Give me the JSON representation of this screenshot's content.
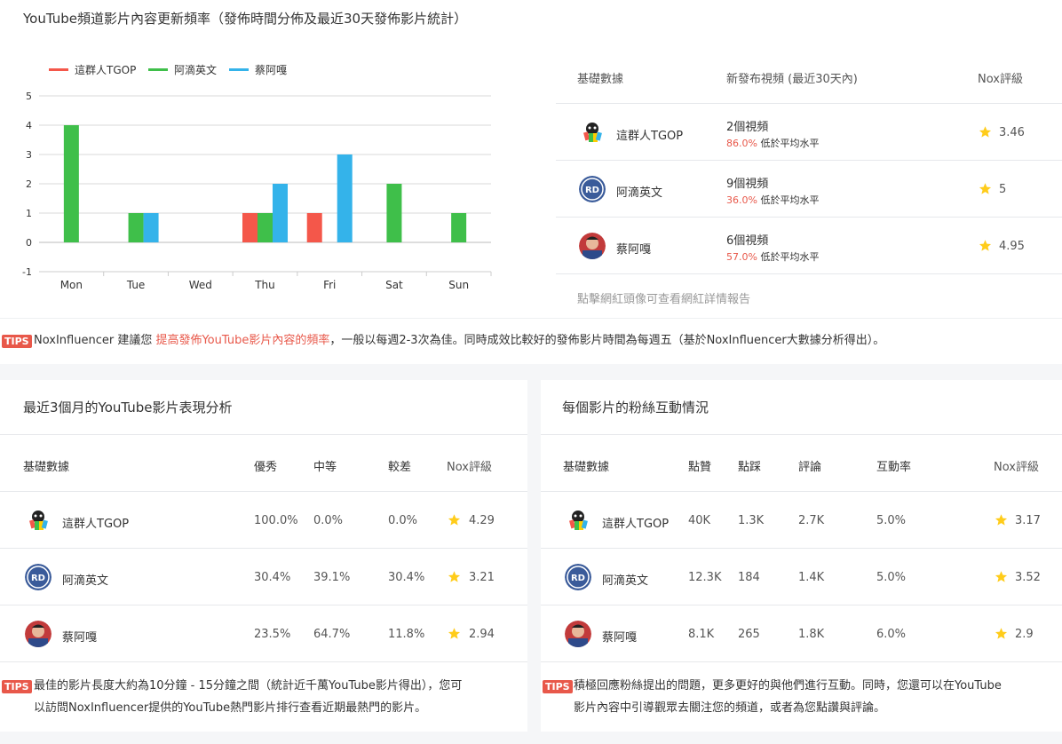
{
  "top": {
    "title": "YouTube頻道影片內容更新頻率（發佈時間分佈及最近30天發佈影片統計）"
  },
  "chart_data": {
    "type": "bar",
    "categories": [
      "Mon",
      "Tue",
      "Wed",
      "Thu",
      "Fri",
      "Sat",
      "Sun"
    ],
    "series": [
      {
        "name": "這群人TGOP",
        "color": "#f4574a",
        "values": [
          0,
          0,
          0,
          1,
          1,
          0,
          0
        ]
      },
      {
        "name": "阿滴英文",
        "color": "#3fbf4a",
        "values": [
          4,
          1,
          0,
          1,
          0,
          2,
          1
        ]
      },
      {
        "name": "蔡阿嘎",
        "color": "#34b3ea",
        "values": [
          0,
          1,
          0,
          2,
          3,
          0,
          0
        ]
      }
    ],
    "yticks": [
      "5",
      "4",
      "3",
      "2",
      "1",
      "0",
      "-1"
    ],
    "ylim": [
      -1,
      5
    ],
    "grid": true,
    "legend": "top-left"
  },
  "stats": {
    "headers": {
      "basic": "基礎數據",
      "new_videos": "新發布視頻 (最近30天內)",
      "nox": "Nox評級"
    },
    "rows": [
      {
        "name": "這群人TGOP",
        "videos": "2個視頻",
        "pct": "86.0%",
        "below": "低於平均水平",
        "rating": "3.46"
      },
      {
        "name": "阿滴英文",
        "videos": "9個視頻",
        "pct": "36.0%",
        "below": "低於平均水平",
        "rating": "5"
      },
      {
        "name": "蔡阿嘎",
        "videos": "6個視頻",
        "pct": "57.0%",
        "below": "低於平均水平",
        "rating": "4.95"
      }
    ],
    "footer": "點擊網紅頭像可查看網紅詳情報告"
  },
  "tips1": {
    "badge": "TIPS",
    "prefix": "NoxInfluencer 建議您 ",
    "highlight": "提高發佈YouTube影片內容的頻率",
    "suffix": "，一般以每週2-3次為佳。同時成效比較好的發佈影片時間為每週五（基於NoxInfluencer大數據分析得出）。"
  },
  "perf": {
    "title": "最近3個月的YouTube影片表現分析",
    "headers": {
      "basic": "基礎數據",
      "excellent": "優秀",
      "medium": "中等",
      "poor": "較差",
      "nox": "Nox評級"
    },
    "rows": [
      {
        "name": "這群人TGOP",
        "excellent": "100.0%",
        "medium": "0.0%",
        "poor": "0.0%",
        "rating": "4.29"
      },
      {
        "name": "阿滴英文",
        "excellent": "30.4%",
        "medium": "39.1%",
        "poor": "30.4%",
        "rating": "3.21"
      },
      {
        "name": "蔡阿嘎",
        "excellent": "23.5%",
        "medium": "64.7%",
        "poor": "11.8%",
        "rating": "2.94"
      }
    ],
    "tips_badge": "TIPS",
    "tips_line1": "最佳的影片長度大約為10分鐘 - 15分鐘之間（統計近千萬YouTube影片得出），您可",
    "tips_line2": "以訪問NoxInfluencer提供的YouTube熱門影片排行查看近期最熱門的影片。"
  },
  "engage": {
    "title": "每個影片的粉絲互動情況",
    "headers": {
      "basic": "基礎數據",
      "likes": "點贊",
      "dislikes": "點踩",
      "comments": "評論",
      "rate": "互動率",
      "nox": "Nox評級"
    },
    "rows": [
      {
        "name": "這群人TGOP",
        "likes": "40K",
        "dislikes": "1.3K",
        "comments": "2.7K",
        "rate": "5.0%",
        "rating": "3.17"
      },
      {
        "name": "阿滴英文",
        "likes": "12.3K",
        "dislikes": "184",
        "comments": "1.4K",
        "rate": "5.0%",
        "rating": "3.52"
      },
      {
        "name": "蔡阿嘎",
        "likes": "8.1K",
        "dislikes": "265",
        "comments": "1.8K",
        "rate": "6.0%",
        "rating": "2.9"
      }
    ],
    "tips_badge": "TIPS",
    "tips_line1": "積極回應粉絲提出的問題，更多更好的與他們進行互動。同時，您還可以在YouTube",
    "tips_line2": "影片內容中引導觀眾去關注您的頻道，或者為您點讚與評論。"
  }
}
